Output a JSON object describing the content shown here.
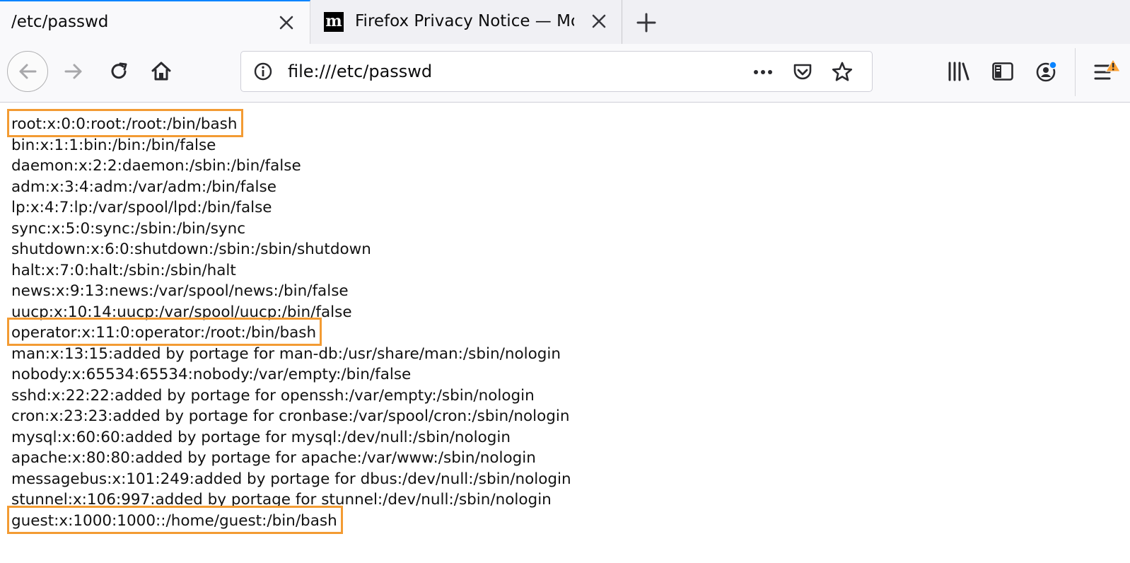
{
  "tabs": [
    {
      "title": "/etc/passwd",
      "active": true,
      "close_icon": "close-icon"
    },
    {
      "title": "Firefox Privacy Notice — Mozilla",
      "active": false,
      "favicon": "m",
      "close_icon": "close-icon"
    }
  ],
  "toolbar": {
    "new_tab_icon": "plus-icon",
    "back_icon": "back-arrow-icon",
    "forward_icon": "forward-arrow-icon",
    "reload_icon": "reload-icon",
    "home_icon": "home-icon",
    "library_icon": "library-icon",
    "sidebar_icon": "sidebar-icon",
    "account_icon": "account-icon",
    "menu_icon": "hamburger-menu-icon"
  },
  "urlbar": {
    "info_icon": "info-icon",
    "url": "file:///etc/passwd",
    "page_actions_icon": "ellipsis-icon",
    "pocket_icon": "pocket-icon",
    "bookmark_icon": "star-icon"
  },
  "highlight_color": "#f39b33",
  "file_lines": [
    {
      "text": "root:x:0:0:root:/root:/bin/bash",
      "highlighted": true
    },
    {
      "text": "bin:x:1:1:bin:/bin:/bin/false",
      "highlighted": false
    },
    {
      "text": "daemon:x:2:2:daemon:/sbin:/bin/false",
      "highlighted": false
    },
    {
      "text": "adm:x:3:4:adm:/var/adm:/bin/false",
      "highlighted": false
    },
    {
      "text": "lp:x:4:7:lp:/var/spool/lpd:/bin/false",
      "highlighted": false
    },
    {
      "text": "sync:x:5:0:sync:/sbin:/bin/sync",
      "highlighted": false
    },
    {
      "text": "shutdown:x:6:0:shutdown:/sbin:/sbin/shutdown",
      "highlighted": false
    },
    {
      "text": "halt:x:7:0:halt:/sbin:/sbin/halt",
      "highlighted": false
    },
    {
      "text": "news:x:9:13:news:/var/spool/news:/bin/false",
      "highlighted": false
    },
    {
      "text": "uucp:x:10:14:uucp:/var/spool/uucp:/bin/false",
      "highlighted": false
    },
    {
      "text": "operator:x:11:0:operator:/root:/bin/bash",
      "highlighted": true
    },
    {
      "text": "man:x:13:15:added by portage for man-db:/usr/share/man:/sbin/nologin",
      "highlighted": false
    },
    {
      "text": "nobody:x:65534:65534:nobody:/var/empty:/bin/false",
      "highlighted": false
    },
    {
      "text": "sshd:x:22:22:added by portage for openssh:/var/empty:/sbin/nologin",
      "highlighted": false
    },
    {
      "text": "cron:x:23:23:added by portage for cronbase:/var/spool/cron:/sbin/nologin",
      "highlighted": false
    },
    {
      "text": "mysql:x:60:60:added by portage for mysql:/dev/null:/sbin/nologin",
      "highlighted": false
    },
    {
      "text": "apache:x:80:80:added by portage for apache:/var/www:/sbin/nologin",
      "highlighted": false
    },
    {
      "text": "messagebus:x:101:249:added by portage for dbus:/dev/null:/sbin/nologin",
      "highlighted": false
    },
    {
      "text": "stunnel:x:106:997:added by portage for stunnel:/dev/null:/sbin/nologin",
      "highlighted": false
    },
    {
      "text": "guest:x:1000:1000::/home/guest:/bin/bash",
      "highlighted": true
    }
  ]
}
